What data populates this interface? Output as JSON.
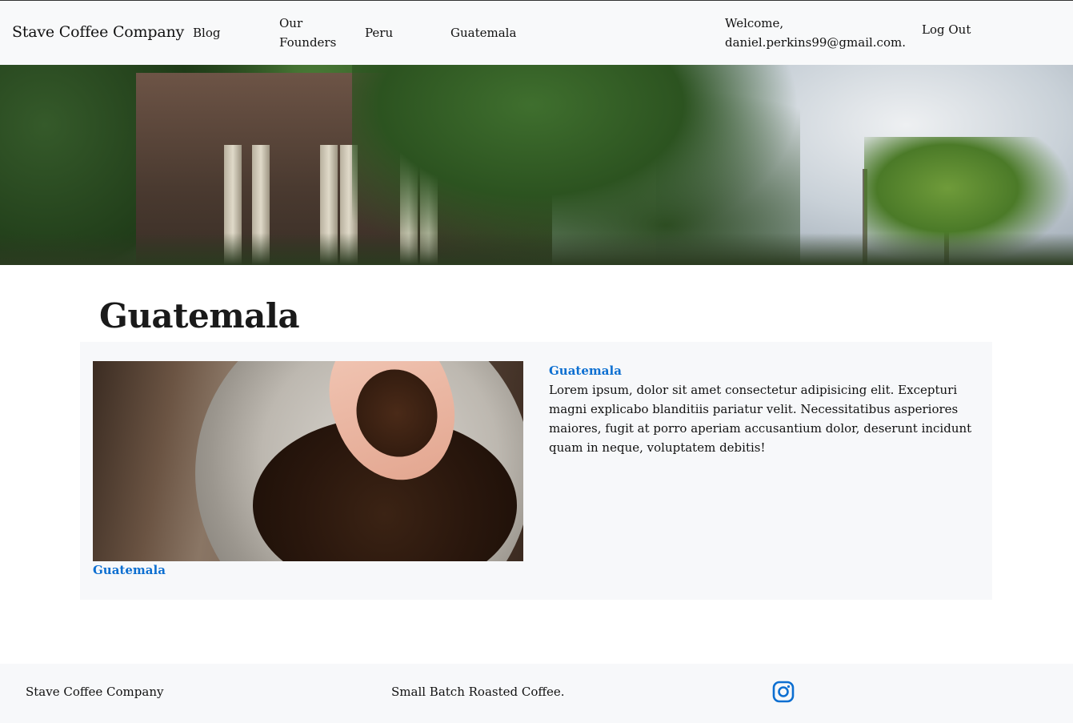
{
  "header": {
    "brand": "Stave Coffee Company",
    "nav": {
      "blog": "Blog",
      "founders": "Our Founders",
      "peru": "Peru",
      "guatemala": "Guatemala"
    },
    "welcome": "Welcome, daniel.perkins99@gmail.com.",
    "logout": "Log Out"
  },
  "main": {
    "title": "Guatemala",
    "card": {
      "image_caption": "Guatemala",
      "heading": "Guatemala",
      "text": "Lorem ipsum, dolor sit amet consectetur adipisicing elit. Excepturi magni explicabo blanditiis pariatur velit. Necessitatibus asperiores maiores, fugit at porro aperiam accusantium dolor, deserunt incidunt quam in neque, voluptatem debitis!"
    }
  },
  "footer": {
    "brand": "Stave Coffee Company",
    "tagline": "Small Batch Roasted Coffee.",
    "social_icon": "instagram-icon"
  },
  "colors": {
    "link": "#0d6fd1",
    "navbar_bg": "#f8f9fa",
    "card_bg": "#f7f8fa"
  }
}
